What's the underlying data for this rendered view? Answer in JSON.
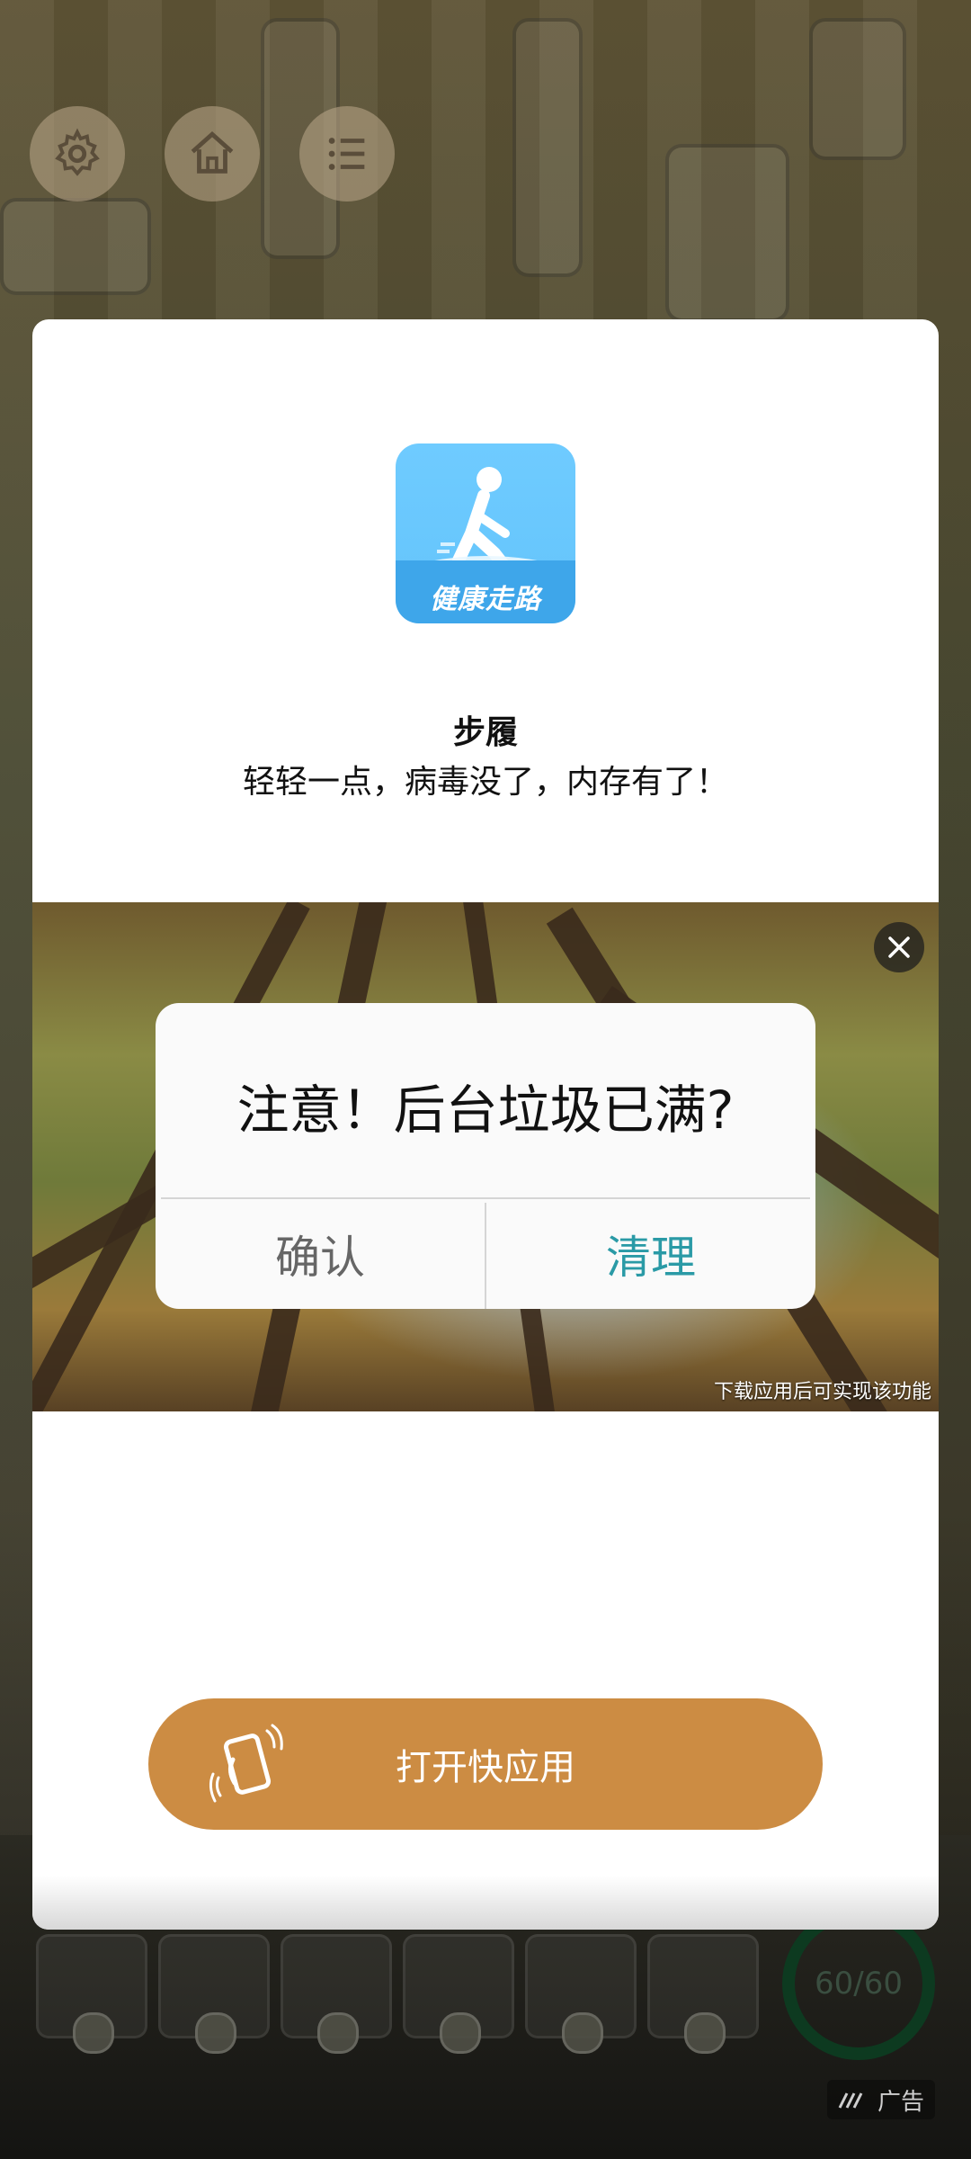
{
  "ad": {
    "app_name": "步履",
    "slogan": "轻轻一点，病毒没了，内存有了！",
    "icon_text": "健康走路",
    "image": {
      "dialog_message": "注意！后台垃圾已满?",
      "confirm_label": "确认",
      "clean_label": "清理",
      "caption": "下载应用后可实现该功能"
    },
    "open_button_label": "打开快应用",
    "badge_label": "广告"
  },
  "background": {
    "energy": "60/60",
    "top_buttons": [
      "gear-icon",
      "home-icon",
      "list-icon"
    ]
  },
  "colors": {
    "accent": "#cc8c43",
    "clean": "#2a9aa6",
    "icon_bg": "#6fcbff"
  }
}
